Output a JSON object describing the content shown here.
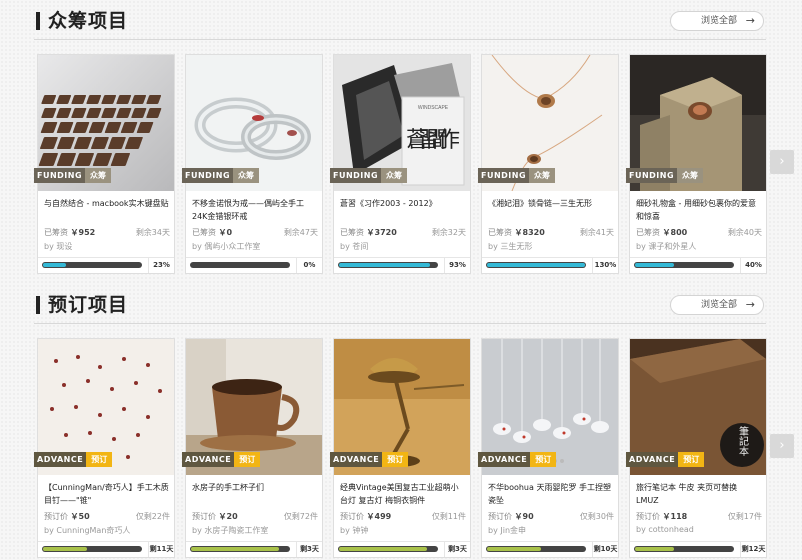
{
  "crowdfunding": {
    "title": "众筹项目",
    "browse_label": "浏览全部",
    "tag_en": "FUNDING",
    "tag_cn": "众筹",
    "items": [
      {
        "title": "与自然结合 - macbook实木键盘贴",
        "raised_label": "已筹资",
        "amount": "￥952",
        "days": "剩余34天",
        "by": "by 现设",
        "percent": "23%",
        "progress": 0.23
      },
      {
        "title": "不移金诺恨为戒——偶屿全手工24K金错银环戒",
        "raised_label": "已筹资",
        "amount": "￥0",
        "days": "剩余47天",
        "by": "by 偶屿小众工作室",
        "percent": "0%",
        "progress": 0.0
      },
      {
        "title": "蒼習《习作2003 - 2012》",
        "raised_label": "已筹资",
        "amount": "￥3720",
        "days": "剩余32天",
        "by": "by 苍间",
        "percent": "93%",
        "progress": 0.93
      },
      {
        "title": "《湘妃泪》锁骨链—三生无形",
        "raised_label": "已筹资",
        "amount": "￥8320",
        "days": "剩余41天",
        "by": "by 三生无形",
        "percent": "130%",
        "progress": 1.0
      },
      {
        "title": "细砂礼物盒 - 用细砂包裹你的爱意和惊喜",
        "raised_label": "已筹资",
        "amount": "￥800",
        "days": "剩余40天",
        "by": "by 课子和外星人",
        "percent": "40%",
        "progress": 0.4
      }
    ]
  },
  "preorder": {
    "title": "预订项目",
    "browse_label": "浏览全部",
    "tag_en": "ADVANCE",
    "tag_cn": "预订",
    "items": [
      {
        "title": "【CunningMan/奇巧人】手工木质目钉——\"锥\"",
        "price_label": "预订价",
        "amount": "￥50",
        "days": "仅剩22件",
        "by": "by CunningMan奇巧人",
        "percent": "剩11天",
        "progress": 0.45
      },
      {
        "title": "水房子的手工杯子们",
        "price_label": "预订价",
        "amount": "￥20",
        "days": "仅剩72件",
        "by": "by 水房子陶瓷工作室",
        "percent": "剩3天",
        "progress": 0.9
      },
      {
        "title": "经典Vintage美国复古工业超萌小台灯 复古灯 梅铜衣铜件",
        "price_label": "预订价",
        "amount": "￥499",
        "days": "仅剩11件",
        "by": "by 钟钟",
        "percent": "剩3天",
        "progress": 0.9
      },
      {
        "title": "不华boohua 天雨婴陀罗 手工捏塑瓷坠",
        "price_label": "预订价",
        "amount": "￥90",
        "days": "仅剩30件",
        "by": "by Jin金申",
        "percent": "剩10天",
        "progress": 0.55
      },
      {
        "title": "旅行笔记本 牛皮 夹页可替换 LMUZ",
        "price_label": "预订价",
        "amount": "￥118",
        "days": "仅剩17件",
        "by": "by cottonhead",
        "percent": "剩12天",
        "progress": 0.4
      }
    ]
  },
  "thumb_texts": {
    "book_cover": "蒼習 間作",
    "book_spine": "WINDSCAPE",
    "notebook_label": "筆記本"
  }
}
